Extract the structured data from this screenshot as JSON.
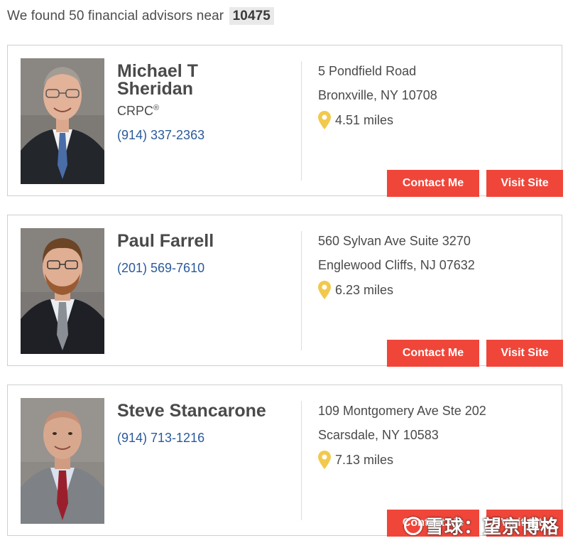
{
  "header": {
    "prefix": "We found 50 financial advisors near",
    "zip": "10475"
  },
  "advisors": [
    {
      "name": "Michael T Sheridan",
      "name_line1": "Michael T",
      "name_line2": "Sheridan",
      "credential": "CRPC",
      "credential_mark": "®",
      "phone": "(914) 337-2363",
      "address_line1": "5 Pondfield Road",
      "address_line2": "Bronxville, NY 10708",
      "distance": "4.51 miles",
      "contact_label": "Contact Me",
      "visit_label": "Visit Site"
    },
    {
      "name": "Paul Farrell",
      "phone": "(201) 569-7610",
      "address_line1": "560 Sylvan Ave Suite 3270",
      "address_line2": "Englewood Cliffs, NJ 07632",
      "distance": "6.23 miles",
      "contact_label": "Contact Me",
      "visit_label": "Visit Site"
    },
    {
      "name": "Steve Stancarone",
      "phone": "(914) 713-1216",
      "address_line1": "109 Montgomery Ave Ste 202",
      "address_line2": "Scarsdale, NY 10583",
      "distance": "7.13 miles",
      "contact_label": "Contact Me",
      "visit_label": "Visit Site"
    }
  ],
  "watermark": {
    "text": "雪球：望京博格"
  },
  "colors": {
    "button": "#f0463a",
    "phone_link": "#2a5a9a",
    "pin": "#f2c94c",
    "zip_bg": "#e9e9e9"
  },
  "icons": {
    "pin": "map-pin-icon",
    "watermark": "snowball-logo-icon"
  }
}
